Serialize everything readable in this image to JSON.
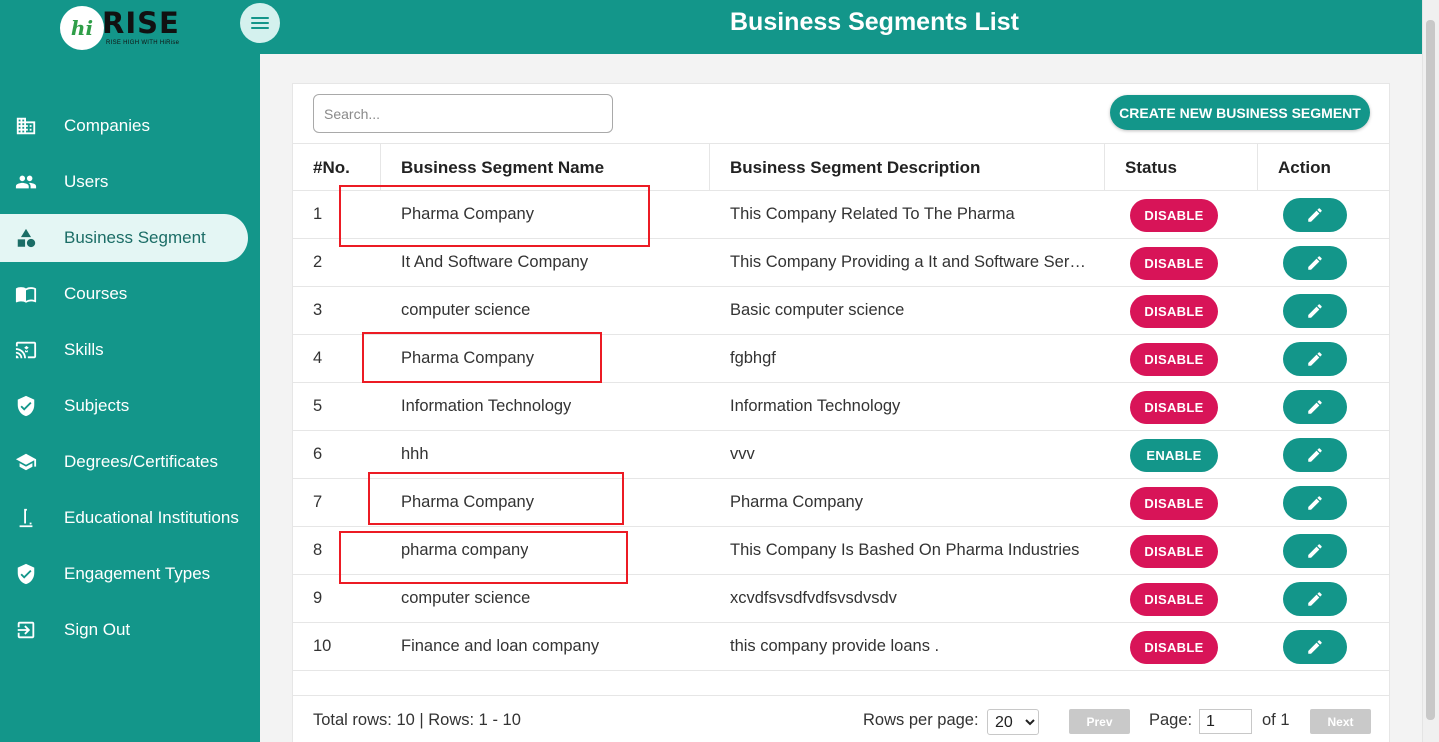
{
  "app": {
    "logo_mark": "hi",
    "logo_word": "RISE",
    "logo_tagline": "RISE HIGH WITH HiRise",
    "page_title": "Business Segments List",
    "accent_color": "#13968a",
    "disable_color": "#d81458"
  },
  "sidebar": {
    "items": [
      {
        "label": "Companies",
        "icon": "building-icon"
      },
      {
        "label": "Users",
        "icon": "users-icon"
      },
      {
        "label": "Business Segment",
        "icon": "shapes-icon",
        "active": true
      },
      {
        "label": "Courses",
        "icon": "book-icon"
      },
      {
        "label": "Skills",
        "icon": "cast-icon"
      },
      {
        "label": "Subjects",
        "icon": "shield-check-icon"
      },
      {
        "label": "Degrees/Certificates",
        "icon": "graduation-cap-icon"
      },
      {
        "label": "Educational Institutions",
        "icon": "podium-icon"
      },
      {
        "label": "Engagement Types",
        "icon": "shield-check-icon"
      },
      {
        "label": "Sign Out",
        "icon": "sign-out-icon"
      }
    ]
  },
  "toolbar": {
    "search_placeholder": "Search...",
    "create_label": "CREATE NEW BUSINESS SEGMENT"
  },
  "table": {
    "headers": {
      "no": "#No.",
      "name": "Business Segment Name",
      "description": "Business Segment Description",
      "status": "Status",
      "action": "Action"
    },
    "rows": [
      {
        "no": "1",
        "name": "Pharma Company",
        "description": "This Company Related To The Pharma",
        "status": "DISABLE"
      },
      {
        "no": "2",
        "name": "It And Software Company",
        "description": "This Company Providing a It and Software Services",
        "status": "DISABLE"
      },
      {
        "no": "3",
        "name": "computer science",
        "description": "Basic computer science",
        "status": "DISABLE"
      },
      {
        "no": "4",
        "name": "Pharma Company",
        "description": "fgbhgf",
        "status": "DISABLE"
      },
      {
        "no": "5",
        "name": "Information Technology",
        "description": "Information Technology",
        "status": "DISABLE"
      },
      {
        "no": "6",
        "name": "hhh",
        "description": "vvv",
        "status": "ENABLE"
      },
      {
        "no": "7",
        "name": "Pharma Company",
        "description": "Pharma Company",
        "status": "DISABLE"
      },
      {
        "no": "8",
        "name": "pharma company",
        "description": "This Company Is Bashed On Pharma Industries",
        "status": "DISABLE"
      },
      {
        "no": "9",
        "name": "computer science",
        "description": "xcvdfsvsdfvdfsvsdvsdv",
        "status": "DISABLE"
      },
      {
        "no": "10",
        "name": "Finance and loan company",
        "description": "this company provide loans .",
        "status": "DISABLE"
      }
    ]
  },
  "footer": {
    "summary": "Total rows: 10 | Rows: 1 - 10",
    "rows_per_page_label": "Rows per page:",
    "rows_per_page": "20",
    "prev_label": "Prev",
    "page_label": "Page:",
    "page_value": "1",
    "page_of": "of 1",
    "next_label": "Next"
  }
}
